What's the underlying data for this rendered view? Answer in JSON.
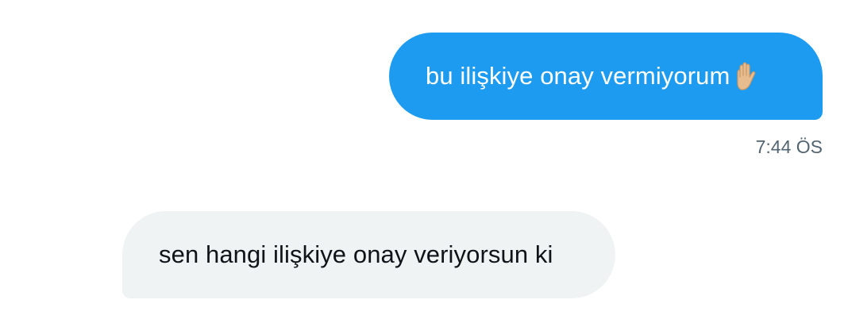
{
  "conversation": {
    "messages": [
      {
        "direction": "outgoing",
        "text": "bu ilişkiye onay vermiyorum",
        "emoji": "raised-hand-icon",
        "timestamp": "7:44 ÖS"
      },
      {
        "direction": "incoming",
        "text": "sen hangi ilişkiye onay veriyorsun ki"
      }
    ]
  },
  "colors": {
    "outgoing_bubble": "#1d9bf0",
    "incoming_bubble": "#eff3f4",
    "timestamp_text": "#536471"
  }
}
